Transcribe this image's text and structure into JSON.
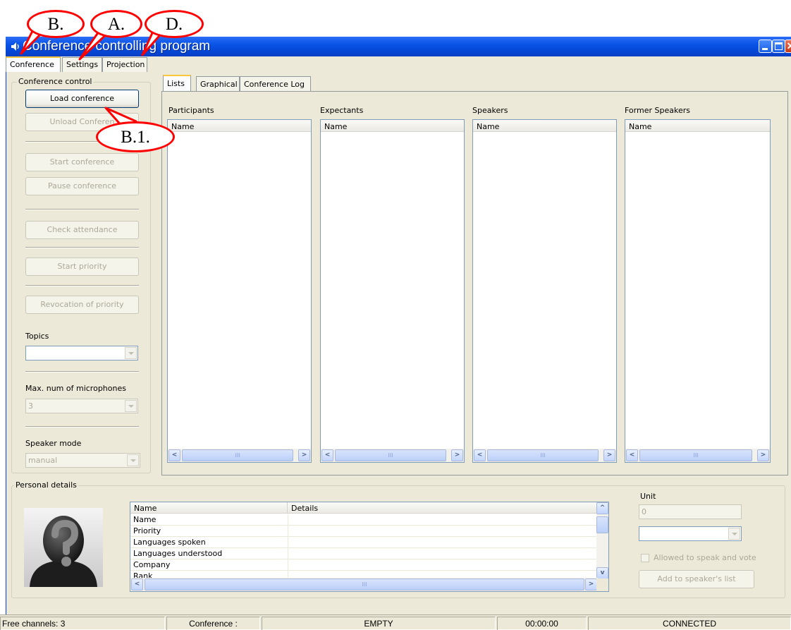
{
  "window": {
    "title": "Conference controlling program"
  },
  "top_tabs": [
    "Conference",
    "Settings",
    "Projection"
  ],
  "conference_control": {
    "title": "Conference control",
    "buttons": {
      "load": "Load conference",
      "unload": "Unload Conferen",
      "start": "Start conference",
      "pause": "Pause conference",
      "attendance": "Check attendance",
      "start_priority": "Start priority",
      "revoke_priority": "Revocation of priority"
    },
    "topics_label": "Topics",
    "topics_value": "",
    "max_mics_label": "Max. num of microphones",
    "max_mics_value": "3",
    "speaker_mode_label": "Speaker mode",
    "speaker_mode_value": "manual"
  },
  "inner_tabs": [
    "Lists",
    "Graphical",
    "Conference Log"
  ],
  "lists": [
    {
      "title": "Participants",
      "column": "Name"
    },
    {
      "title": "Expectants",
      "column": "Name"
    },
    {
      "title": "Speakers",
      "column": "Name"
    },
    {
      "title": "Former Speakers",
      "column": "Name"
    }
  ],
  "personal_details": {
    "title": "Personal details",
    "columns": [
      "Name",
      "Details"
    ],
    "rows": [
      "Name",
      "Priority",
      "Languages spoken",
      "Languages understood",
      "Company",
      "Rank"
    ],
    "unit_label": "Unit",
    "unit_value": "0",
    "allowed_label": "Allowed to speak and vote",
    "add_button": "Add to speaker's list"
  },
  "status": {
    "free_channels": "Free channels: 3",
    "conference_label": "Conference :",
    "state": "EMPTY",
    "time": "00:00:00",
    "connection": "CONNECTED"
  },
  "scroll_thumb_glyph": "III",
  "annotations": [
    "B.",
    "A.",
    "D.",
    "B.1."
  ],
  "colors": {
    "titlebar": "#0b55e8",
    "callout": "#ff0000",
    "tab_highlight": "#ffc73c"
  }
}
